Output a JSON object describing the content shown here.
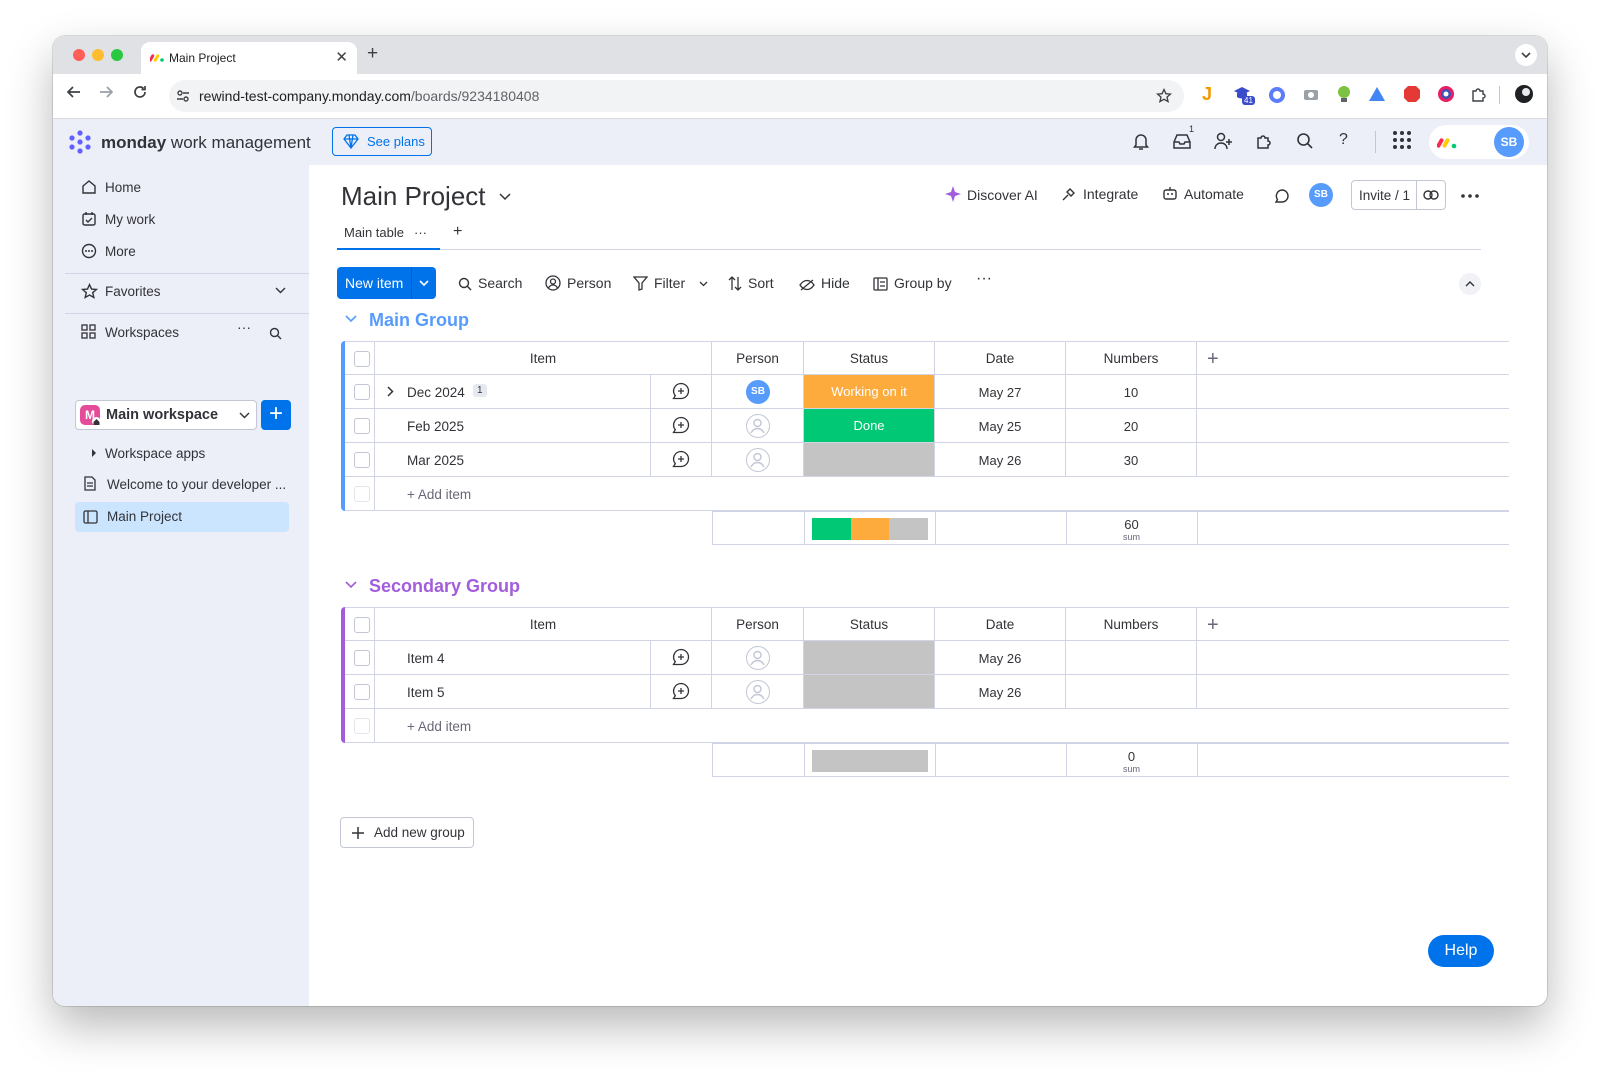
{
  "browser": {
    "tab_title": "Main Project",
    "url_host": "rewind-test-company.monday.com",
    "url_path": "/boards/9234180408",
    "ext_badge": "41",
    "inbox_badge": "1"
  },
  "app": {
    "brand_bold": "monday",
    "brand_rest": " work management",
    "see_plans": "See plans",
    "user_initials": "SB"
  },
  "sidebar": {
    "home": "Home",
    "my_work": "My work",
    "more": "More",
    "favorites": "Favorites",
    "workspaces": "Workspaces",
    "workspace_name": "Main workspace",
    "workspace_letter": "M",
    "workspace_apps": "Workspace apps",
    "welcome_doc": "Welcome to your developer ...",
    "main_project": "Main Project"
  },
  "board": {
    "title": "Main Project",
    "discover_ai": "Discover AI",
    "integrate": "Integrate",
    "automate": "Automate",
    "owner_initials": "SB",
    "invite": "Invite / 1",
    "main_table_tab": "Main table",
    "new_item": "New item",
    "toolbar": {
      "search": "Search",
      "person": "Person",
      "filter": "Filter",
      "sort": "Sort",
      "hide": "Hide",
      "group_by": "Group by"
    },
    "columns": {
      "item": "Item",
      "person": "Person",
      "status": "Status",
      "date": "Date",
      "numbers": "Numbers"
    },
    "add_item": "+ Add item",
    "add_new_group": "Add new group",
    "sum_label": "sum"
  },
  "groups": [
    {
      "title": "Main Group",
      "color": "#579bfc",
      "rows": [
        {
          "name": "Dec 2024",
          "subitems": "1",
          "person": "SB",
          "status": "Working on it",
          "status_color": "#fdab3d",
          "date": "May 27",
          "number": "10"
        },
        {
          "name": "Feb 2025",
          "person": "",
          "status": "Done",
          "status_color": "#00c875",
          "date": "May 25",
          "number": "20"
        },
        {
          "name": "Mar 2025",
          "person": "",
          "status": "",
          "status_color": "#c4c4c4",
          "date": "May 26",
          "number": "30"
        }
      ],
      "sum": "60",
      "status_summary": [
        {
          "color": "#00c875",
          "fraction": 0.333
        },
        {
          "color": "#fdab3d",
          "fraction": 0.333
        },
        {
          "color": "#c4c4c4",
          "fraction": 0.334
        }
      ]
    },
    {
      "title": "Secondary Group",
      "color": "#a25ddc",
      "rows": [
        {
          "name": "Item 4",
          "person": "",
          "status": "",
          "status_color": "#c4c4c4",
          "date": "May 26",
          "number": ""
        },
        {
          "name": "Item 5",
          "person": "",
          "status": "",
          "status_color": "#c4c4c4",
          "date": "May 26",
          "number": ""
        }
      ],
      "sum": "0",
      "status_summary": [
        {
          "color": "#c4c4c4",
          "fraction": 1.0
        }
      ]
    }
  ],
  "help": "Help"
}
